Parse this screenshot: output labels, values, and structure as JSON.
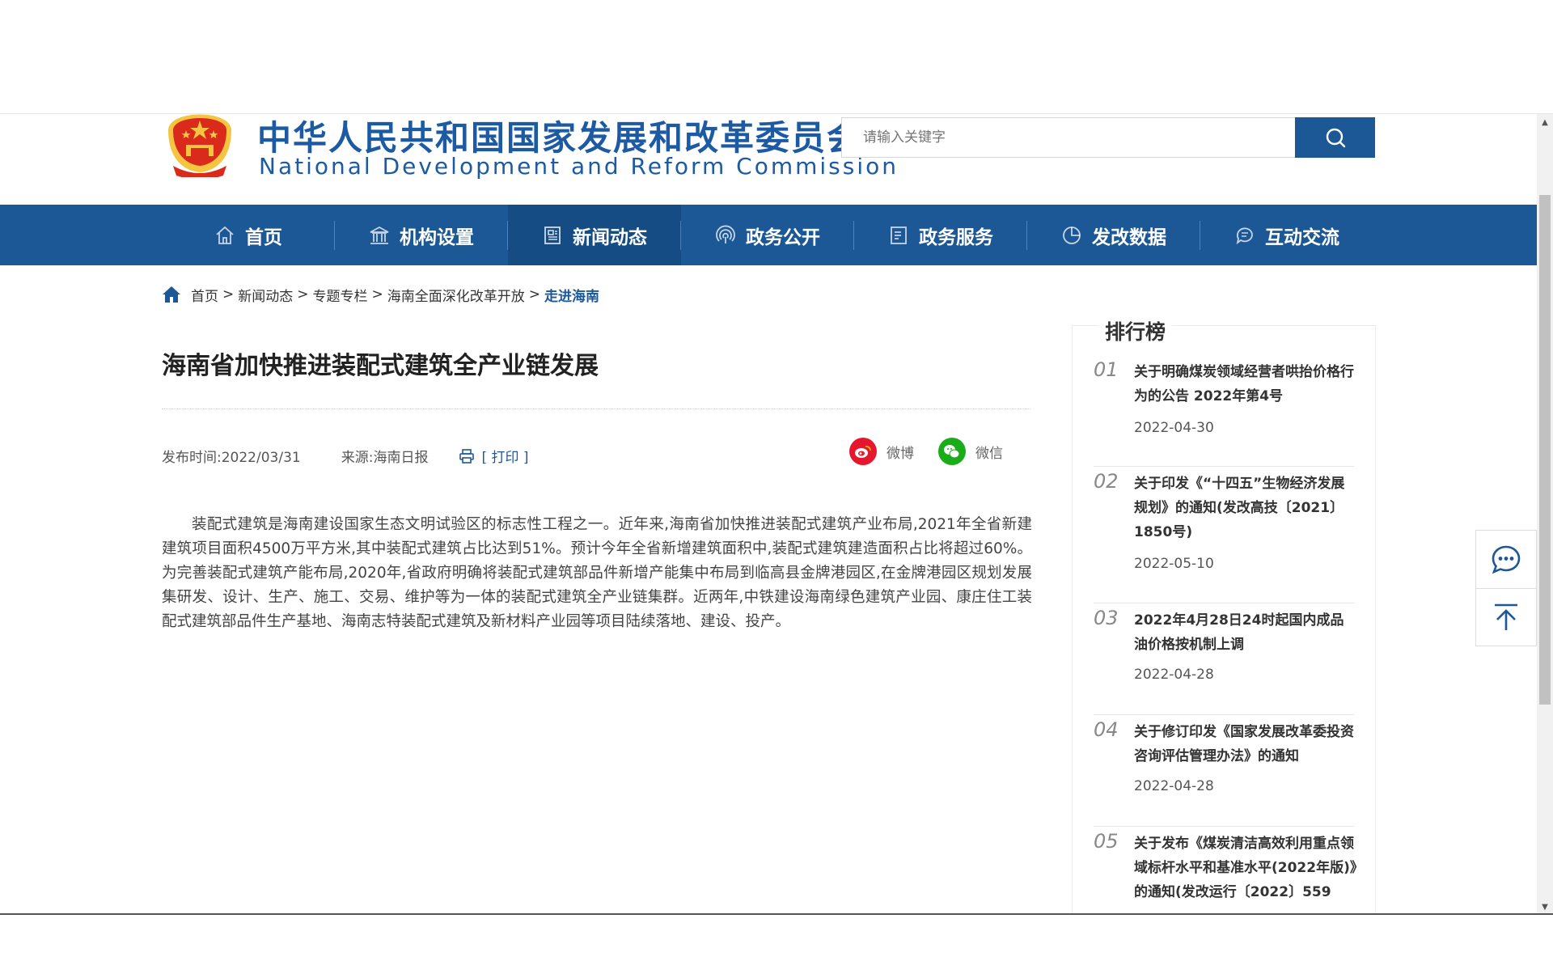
{
  "header": {
    "brand_cn": "中华人民共和国国家发展和改革委员会",
    "brand_en": "National Development and Reform Commission",
    "search_placeholder": "请输入关键字",
    "colors": {
      "brand_blue": "#1d5896",
      "emblem_red": "#d92a1c",
      "emblem_gold": "#f5c542"
    }
  },
  "nav": {
    "items": [
      {
        "label": "首页",
        "icon": "home-icon"
      },
      {
        "label": "机构设置",
        "icon": "building-icon"
      },
      {
        "label": "新闻动态",
        "icon": "newspaper-icon"
      },
      {
        "label": "政务公开",
        "icon": "broadcast-icon"
      },
      {
        "label": "政务服务",
        "icon": "document-icon"
      },
      {
        "label": "发改数据",
        "icon": "pie-chart-icon"
      },
      {
        "label": "互动交流",
        "icon": "chat-icon"
      }
    ],
    "active_label": "新闻动态"
  },
  "breadcrumb": {
    "items": [
      "首页",
      "新闻动态",
      "专题专栏",
      "海南全面深化改革开放"
    ],
    "current": "走进海南",
    "separator": ">"
  },
  "article": {
    "title": "海南省加快推进装配式建筑全产业链发展",
    "publish_label": "发布时间:2022/03/31",
    "source_label": "来源:海南日报",
    "print_label": "[ 打印 ]",
    "share": {
      "weibo": "微博",
      "wechat": "微信"
    },
    "body": "装配式建筑是海南建设国家生态文明试验区的标志性工程之一。近年来,海南省加快推进装配式建筑产业布局,2021年全省新建建筑项目面积4500万平方米,其中装配式建筑占比达到51%。预计今年全省新增建筑面积中,装配式建筑建造面积占比将超过60%。为完善装配式建筑产能布局,2020年,省政府明确将装配式建筑部品件新增产能集中布局到临高县金牌港园区,在金牌港园区规划发展集研发、设计、生产、施工、交易、维护等为一体的装配式建筑全产业链集群。近两年,中铁建设海南绿色建筑产业园、康庄住工装配式建筑部品件生产基地、海南志特装配式建筑及新材料产业园等项目陆续落地、建设、投产。"
  },
  "ranking": {
    "title": "排行榜",
    "items": [
      {
        "num": "01",
        "text": "关于明确煤炭领域经营者哄抬价格行为的公告 2022年第4号",
        "date": "2022-04-30"
      },
      {
        "num": "02",
        "text": "关于印发《“十四五”生物经济发展规划》的通知(发改高技〔2021〕1850号)",
        "date": "2022-05-10"
      },
      {
        "num": "03",
        "text": "2022年4月28日24时起国内成品油价格按机制上调",
        "date": "2022-04-28"
      },
      {
        "num": "04",
        "text": "关于修订印发《国家发展改革委投资咨询评估管理办法》的通知",
        "date": "2022-04-28"
      },
      {
        "num": "05",
        "text": "关于发布《煤炭清洁高效利用重点领域标杆水平和基准水平(2022年版)》的通知(发改运行〔2022〕559",
        "date": ""
      }
    ]
  },
  "float_tools": {
    "icons": [
      "message-icon",
      "back-to-top-icon"
    ]
  }
}
